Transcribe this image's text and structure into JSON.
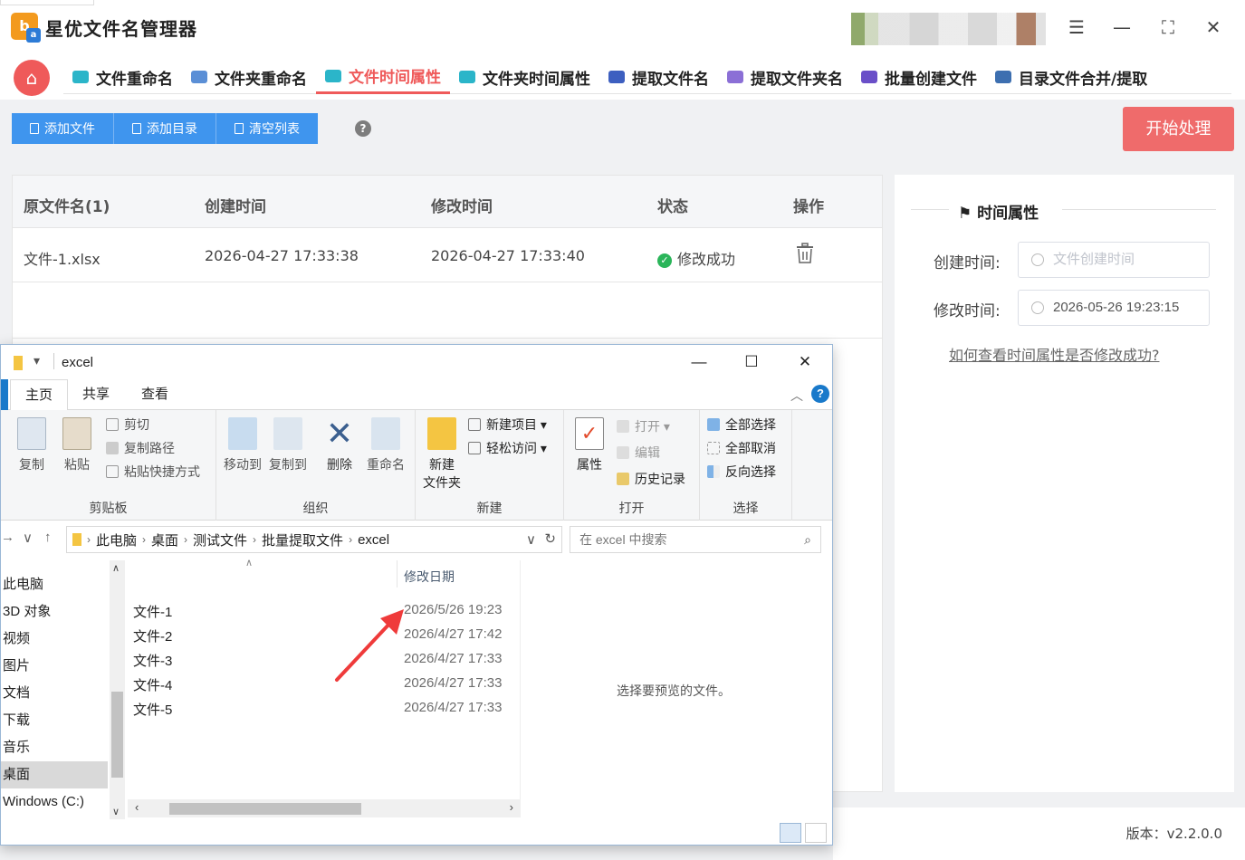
{
  "app": {
    "title": "星优文件名管理器",
    "logo_text": "b",
    "logo_sub": "a"
  },
  "nav": {
    "tabs": [
      {
        "label": "文件重命名",
        "color": "#2bb5c9"
      },
      {
        "label": "文件夹重命名",
        "color": "#5b8fd6"
      },
      {
        "label": "文件时间属性",
        "color": "#2bb5c9",
        "active": true
      },
      {
        "label": "文件夹时间属性",
        "color": "#2bb5c9"
      },
      {
        "label": "提取文件名",
        "color": "#3d5fc0"
      },
      {
        "label": "提取文件夹名",
        "color": "#8b6fd6"
      },
      {
        "label": "批量创建文件",
        "color": "#6a4fc8"
      },
      {
        "label": "目录文件合并/提取",
        "color": "#3d6fb0"
      }
    ]
  },
  "toolbar": {
    "add_file": "添加文件",
    "add_dir": "添加目录",
    "clear_list": "清空列表",
    "help": "?",
    "start": "开始处理"
  },
  "table": {
    "headers": {
      "name": "原文件名(1)",
      "created": "创建时间",
      "modified": "修改时间",
      "status": "状态",
      "action": "操作"
    },
    "rows": [
      {
        "name": "文件-1.xlsx",
        "created": "2026-04-27 17:33:38",
        "modified": "2026-04-27 17:33:40",
        "status": "修改成功"
      }
    ]
  },
  "side": {
    "title": "时间属性",
    "created_label": "创建时间:",
    "created_placeholder": "文件创建时间",
    "modified_label": "修改时间:",
    "modified_value": "2026-05-26 19:23:15",
    "help_link": "如何查看时间属性是否修改成功?"
  },
  "footer": {
    "version": "版本：v2.2.0.0"
  },
  "explorer": {
    "title": "excel",
    "ribbon_tabs": [
      "主页",
      "共享",
      "查看"
    ],
    "clipboard": {
      "copy": "复制",
      "paste": "粘贴",
      "cut": "剪切",
      "copy_path": "复制路径",
      "paste_shortcut": "粘贴快捷方式",
      "group": "剪贴板"
    },
    "organize": {
      "move_to": "移动到",
      "copy_to": "复制到",
      "delete": "删除",
      "rename": "重命名",
      "group": "组织"
    },
    "new": {
      "new_folder_1": "新建",
      "new_folder_2": "文件夹",
      "new_item": "新建项目",
      "easy_access": "轻松访问",
      "group": "新建"
    },
    "open": {
      "properties": "属性",
      "open": "打开",
      "edit": "编辑",
      "history": "历史记录",
      "group": "打开"
    },
    "select": {
      "select_all": "全部选择",
      "select_none": "全部取消",
      "invert": "反向选择",
      "group": "选择"
    },
    "breadcrumb": [
      "此电脑",
      "桌面",
      "测试文件",
      "批量提取文件",
      "excel"
    ],
    "search_placeholder": "在 excel 中搜索",
    "nav_items": [
      "此电脑",
      "3D 对象",
      "视频",
      "图片",
      "文档",
      "下载",
      "音乐",
      "桌面",
      "Windows (C:)"
    ],
    "nav_selected": "桌面",
    "column_date": "修改日期",
    "files": [
      {
        "name": "文件-1",
        "date": "2026/5/26 19:23"
      },
      {
        "name": "文件-2",
        "date": "2026/4/27 17:42"
      },
      {
        "name": "文件-3",
        "date": "2026/4/27 17:33"
      },
      {
        "name": "文件-4",
        "date": "2026/4/27 17:33"
      },
      {
        "name": "文件-5",
        "date": "2026/4/27 17:33"
      }
    ],
    "preview_msg": "选择要预览的文件。"
  }
}
